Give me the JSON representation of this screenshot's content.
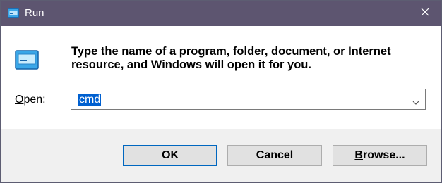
{
  "window": {
    "title": "Run",
    "icon": "run-icon",
    "close_icon": "close-icon"
  },
  "content": {
    "icon": "run-program-icon",
    "instruction": "Type the name of a program, folder, document, or Internet resource, and Windows will open it for you.",
    "open_label_accel": "O",
    "open_label_rest": "pen:",
    "open_value": "cmd",
    "dropdown_icon": "chevron-down-icon"
  },
  "buttons": {
    "ok": "OK",
    "cancel": "Cancel",
    "browse_accel": "B",
    "browse_rest": "rowse..."
  },
  "colors": {
    "titlebar": "#5d5570",
    "selection": "#0060d0",
    "accent": "#0067c0"
  }
}
